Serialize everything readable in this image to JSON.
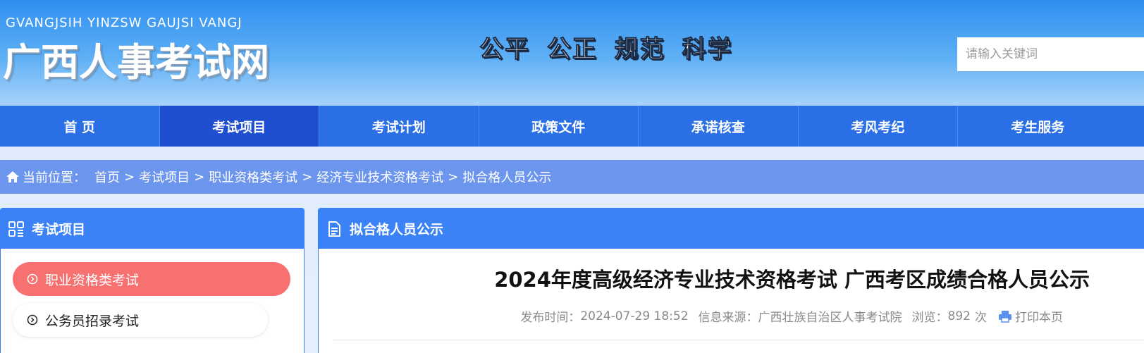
{
  "header": {
    "logo_en": "GVANGJSIH YINZSW GAUJSI VANGJ",
    "logo_cn": "广西人事考试网",
    "slogan": "公平 公正 规范 科学",
    "search_placeholder": "请输入关键词"
  },
  "nav": {
    "items": [
      "首 页",
      "考试项目",
      "考试计划",
      "政策文件",
      "承诺核查",
      "考风考纪",
      "考生服务"
    ],
    "active_index": 1
  },
  "breadcrumb": {
    "label": "当前位置：",
    "items": [
      "首页",
      "考试项目",
      "职业资格类考试",
      "经济专业技术资格考试",
      "拟合格人员公示"
    ],
    "separator": ">"
  },
  "sidebar": {
    "title": "考试项目",
    "items": [
      "职业资格类考试",
      "公务员招录考试"
    ]
  },
  "main": {
    "title": "拟合格人员公示",
    "article_title": "2024年度高级经济专业技术资格考试 广西考区成绩合格人员公示",
    "meta": {
      "publish_label": "发布时间：",
      "publish_time": "2024-07-29 18:52",
      "source_label": "信息来源：",
      "source": "广西壮族自治区人事考试院",
      "views_label": "浏览：",
      "views": "892",
      "views_unit": "次",
      "print": "打印本页"
    }
  },
  "colors": {
    "nav_bg": "#2a6fe6",
    "nav_active": "#1d4fd0",
    "panel_head": "#3b82f6",
    "sidebar_active": "#f87171",
    "breadcrumb_bg": "#6c95ee"
  }
}
